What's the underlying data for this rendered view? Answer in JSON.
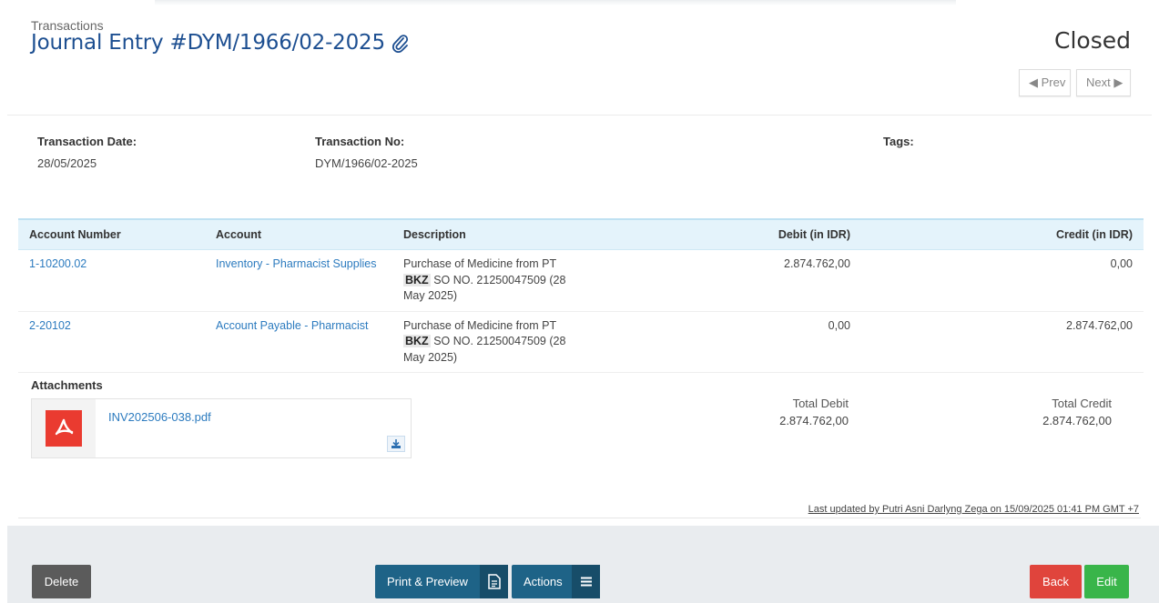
{
  "header": {
    "breadcrumb": "Transactions",
    "title": "Journal Entry #DYM/1966/02-2025",
    "status": "Closed",
    "prev_label": "Prev",
    "next_label": "Next"
  },
  "info": {
    "date_label": "Transaction Date:",
    "date_value": "28/05/2025",
    "no_label": "Transaction No:",
    "no_value": "DYM/1966/02-2025",
    "tags_label": "Tags:"
  },
  "table": {
    "headers": {
      "account_number": "Account Number",
      "account": "Account",
      "description": "Description",
      "debit": "Debit (in IDR)",
      "credit": "Credit (in IDR)"
    },
    "rows": [
      {
        "account_number": "1-10200.02",
        "account": "Inventory - Pharmacist Supplies",
        "desc_line1": "Purchase of Medicine from PT",
        "desc_highlight": "BKZ",
        "desc_line2": "SO NO. 21250047509 (28",
        "desc_line3": "May 2025)",
        "debit": "2.874.762,00",
        "credit": "0,00"
      },
      {
        "account_number": "2-20102",
        "account": "Account Payable - Pharmacist",
        "desc_line1": "Purchase of Medicine from PT",
        "desc_highlight": "BKZ",
        "desc_line2": "SO NO. 21250047509 (28",
        "desc_line3": "May 2025)",
        "debit": "0,00",
        "credit": "2.874.762,00"
      }
    ]
  },
  "attachments": {
    "title": "Attachments",
    "file_name": "INV202506-038.pdf"
  },
  "totals": {
    "debit_label": "Total Debit",
    "debit_value": "2.874.762,00",
    "credit_label": "Total Credit",
    "credit_value": "2.874.762,00"
  },
  "last_updated": "Last updated by Putri Asni Darlyng Zega on 15/09/2025 01:41 PM GMT +7",
  "footer": {
    "delete_label": "Delete",
    "print_label": "Print & Preview",
    "actions_label": "Actions",
    "back_label": "Back",
    "edit_label": "Edit"
  },
  "colors": {
    "title_blue": "#1d4f91",
    "link_blue": "#2c7bbf",
    "table_header_bg": "#e4f3fb",
    "primary_button": "#1e6387",
    "danger_button": "#e0443c",
    "success_button": "#39b54a",
    "neutral_button": "#5b5b5b",
    "pdf_red": "#ea3b30"
  }
}
